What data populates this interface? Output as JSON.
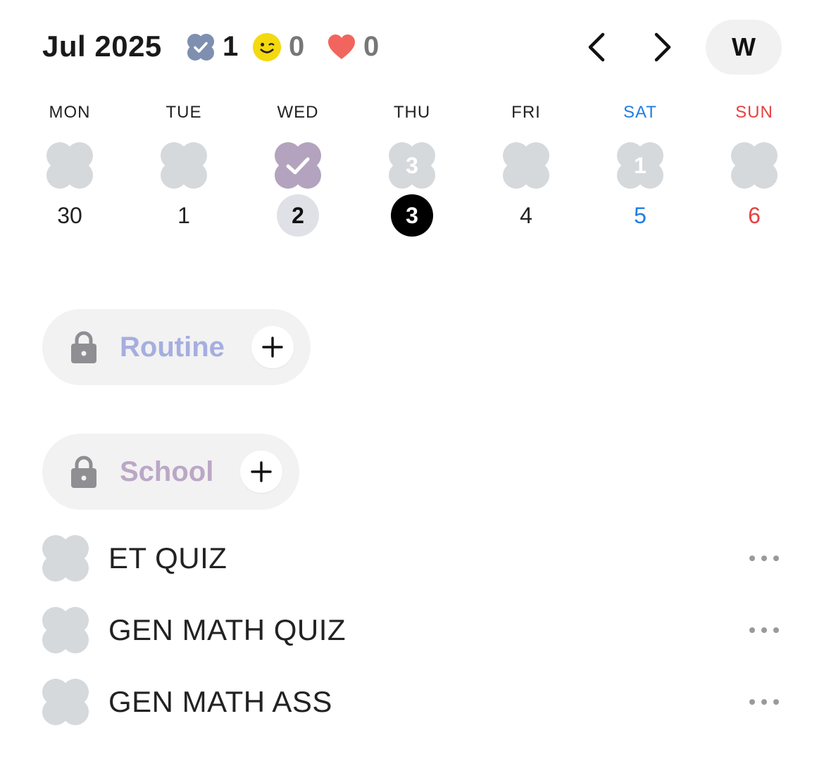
{
  "header": {
    "month_label": "Jul 2025",
    "stats": {
      "completed": "1",
      "smile": "0",
      "heart": "0"
    },
    "view_toggle": "W"
  },
  "week": {
    "days": [
      {
        "name": "MON",
        "date": "30",
        "blob_count": "",
        "state": "empty"
      },
      {
        "name": "TUE",
        "date": "1",
        "blob_count": "",
        "state": "empty"
      },
      {
        "name": "WED",
        "date": "2",
        "blob_count": "",
        "state": "done"
      },
      {
        "name": "THU",
        "date": "3",
        "blob_count": "3",
        "state": "count"
      },
      {
        "name": "FRI",
        "date": "4",
        "blob_count": "",
        "state": "empty"
      },
      {
        "name": "SAT",
        "date": "5",
        "blob_count": "1",
        "state": "count"
      },
      {
        "name": "SUN",
        "date": "6",
        "blob_count": "",
        "state": "empty"
      }
    ]
  },
  "categories": [
    {
      "label": "Routine",
      "color": "#a6aee0"
    },
    {
      "label": "School",
      "color": "#bba7c6"
    }
  ],
  "tasks": [
    {
      "title": "ET QUIZ"
    },
    {
      "title": "GEN MATH QUIZ"
    },
    {
      "title": "GEN MATH ASS"
    }
  ],
  "colors": {
    "blob_empty": "#d5d9dc",
    "blob_done": "#b3a3be",
    "check_badge": "#7e8fb0",
    "smile": "#f5d90f",
    "heart": "#f2655e",
    "saturday": "#1e7ee6",
    "sunday": "#e8413f"
  },
  "icons": [
    "check-badge-icon",
    "smile-icon",
    "heart-icon",
    "chevron-left-icon",
    "chevron-right-icon",
    "lock-icon",
    "plus-icon",
    "more-icon",
    "flower-blob-icon"
  ]
}
